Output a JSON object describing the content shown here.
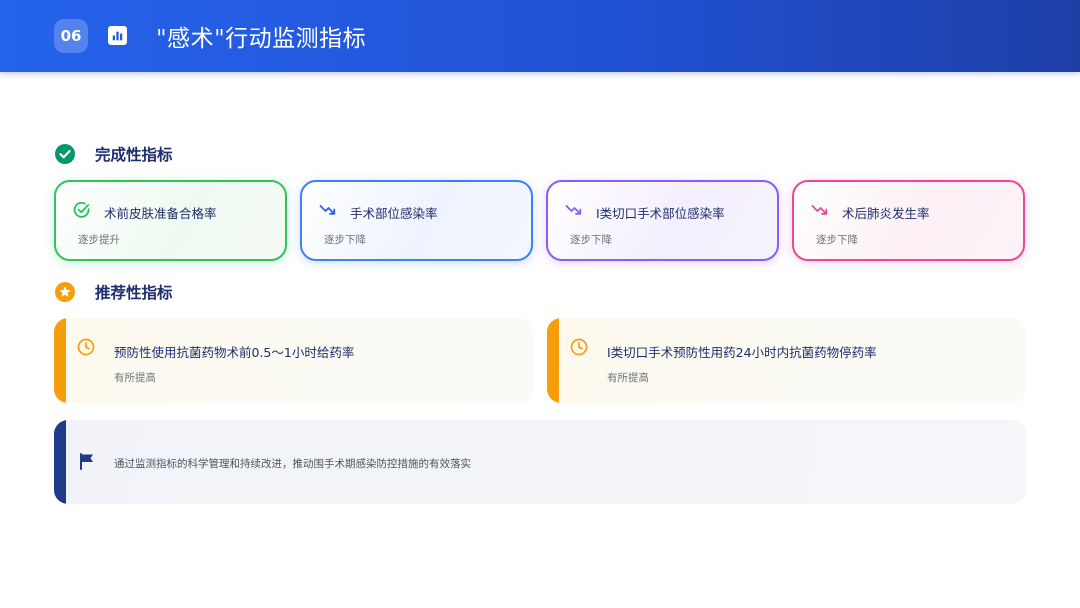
{
  "header": {
    "badge": "06",
    "icon": "bar-chart-icon",
    "title": "\"感术\"行动监测指标",
    "color": "#2563eb"
  },
  "completion": {
    "label": "完成性指标",
    "icon": "check-circle-icon",
    "cards": [
      {
        "title": "术前皮肤准备合格率",
        "status": "逐步提升",
        "icon": "check-circle-outline-icon",
        "color": "#22c55e"
      },
      {
        "title": "手术部位感染率",
        "status": "逐步下降",
        "icon": "trend-down-icon",
        "color": "#3b82f6"
      },
      {
        "title": "I类切口手术部位感染率",
        "status": "逐步下降",
        "icon": "trend-down-icon",
        "color": "#8b5cf6"
      },
      {
        "title": "术后肺炎发生率",
        "status": "逐步下降",
        "icon": "trend-down-icon",
        "color": "#ec4899"
      }
    ]
  },
  "recommended": {
    "label": "推荐性指标",
    "icon": "star-circle-icon",
    "color": "#f59e0b",
    "items": [
      {
        "title": "预防性使用抗菌药物术前0.5～1小时给药率",
        "status": "有所提高",
        "icon": "clock-icon"
      },
      {
        "title": "I类切口手术预防性用药24小时内抗菌药物停药率",
        "status": "有所提高",
        "icon": "clock-icon"
      }
    ]
  },
  "note": {
    "text": "通过监测指标的科学管理和持续改进，推动围手术期感染防控措施的有效落实",
    "icon": "flag-icon",
    "color": "#1e3a8a"
  }
}
